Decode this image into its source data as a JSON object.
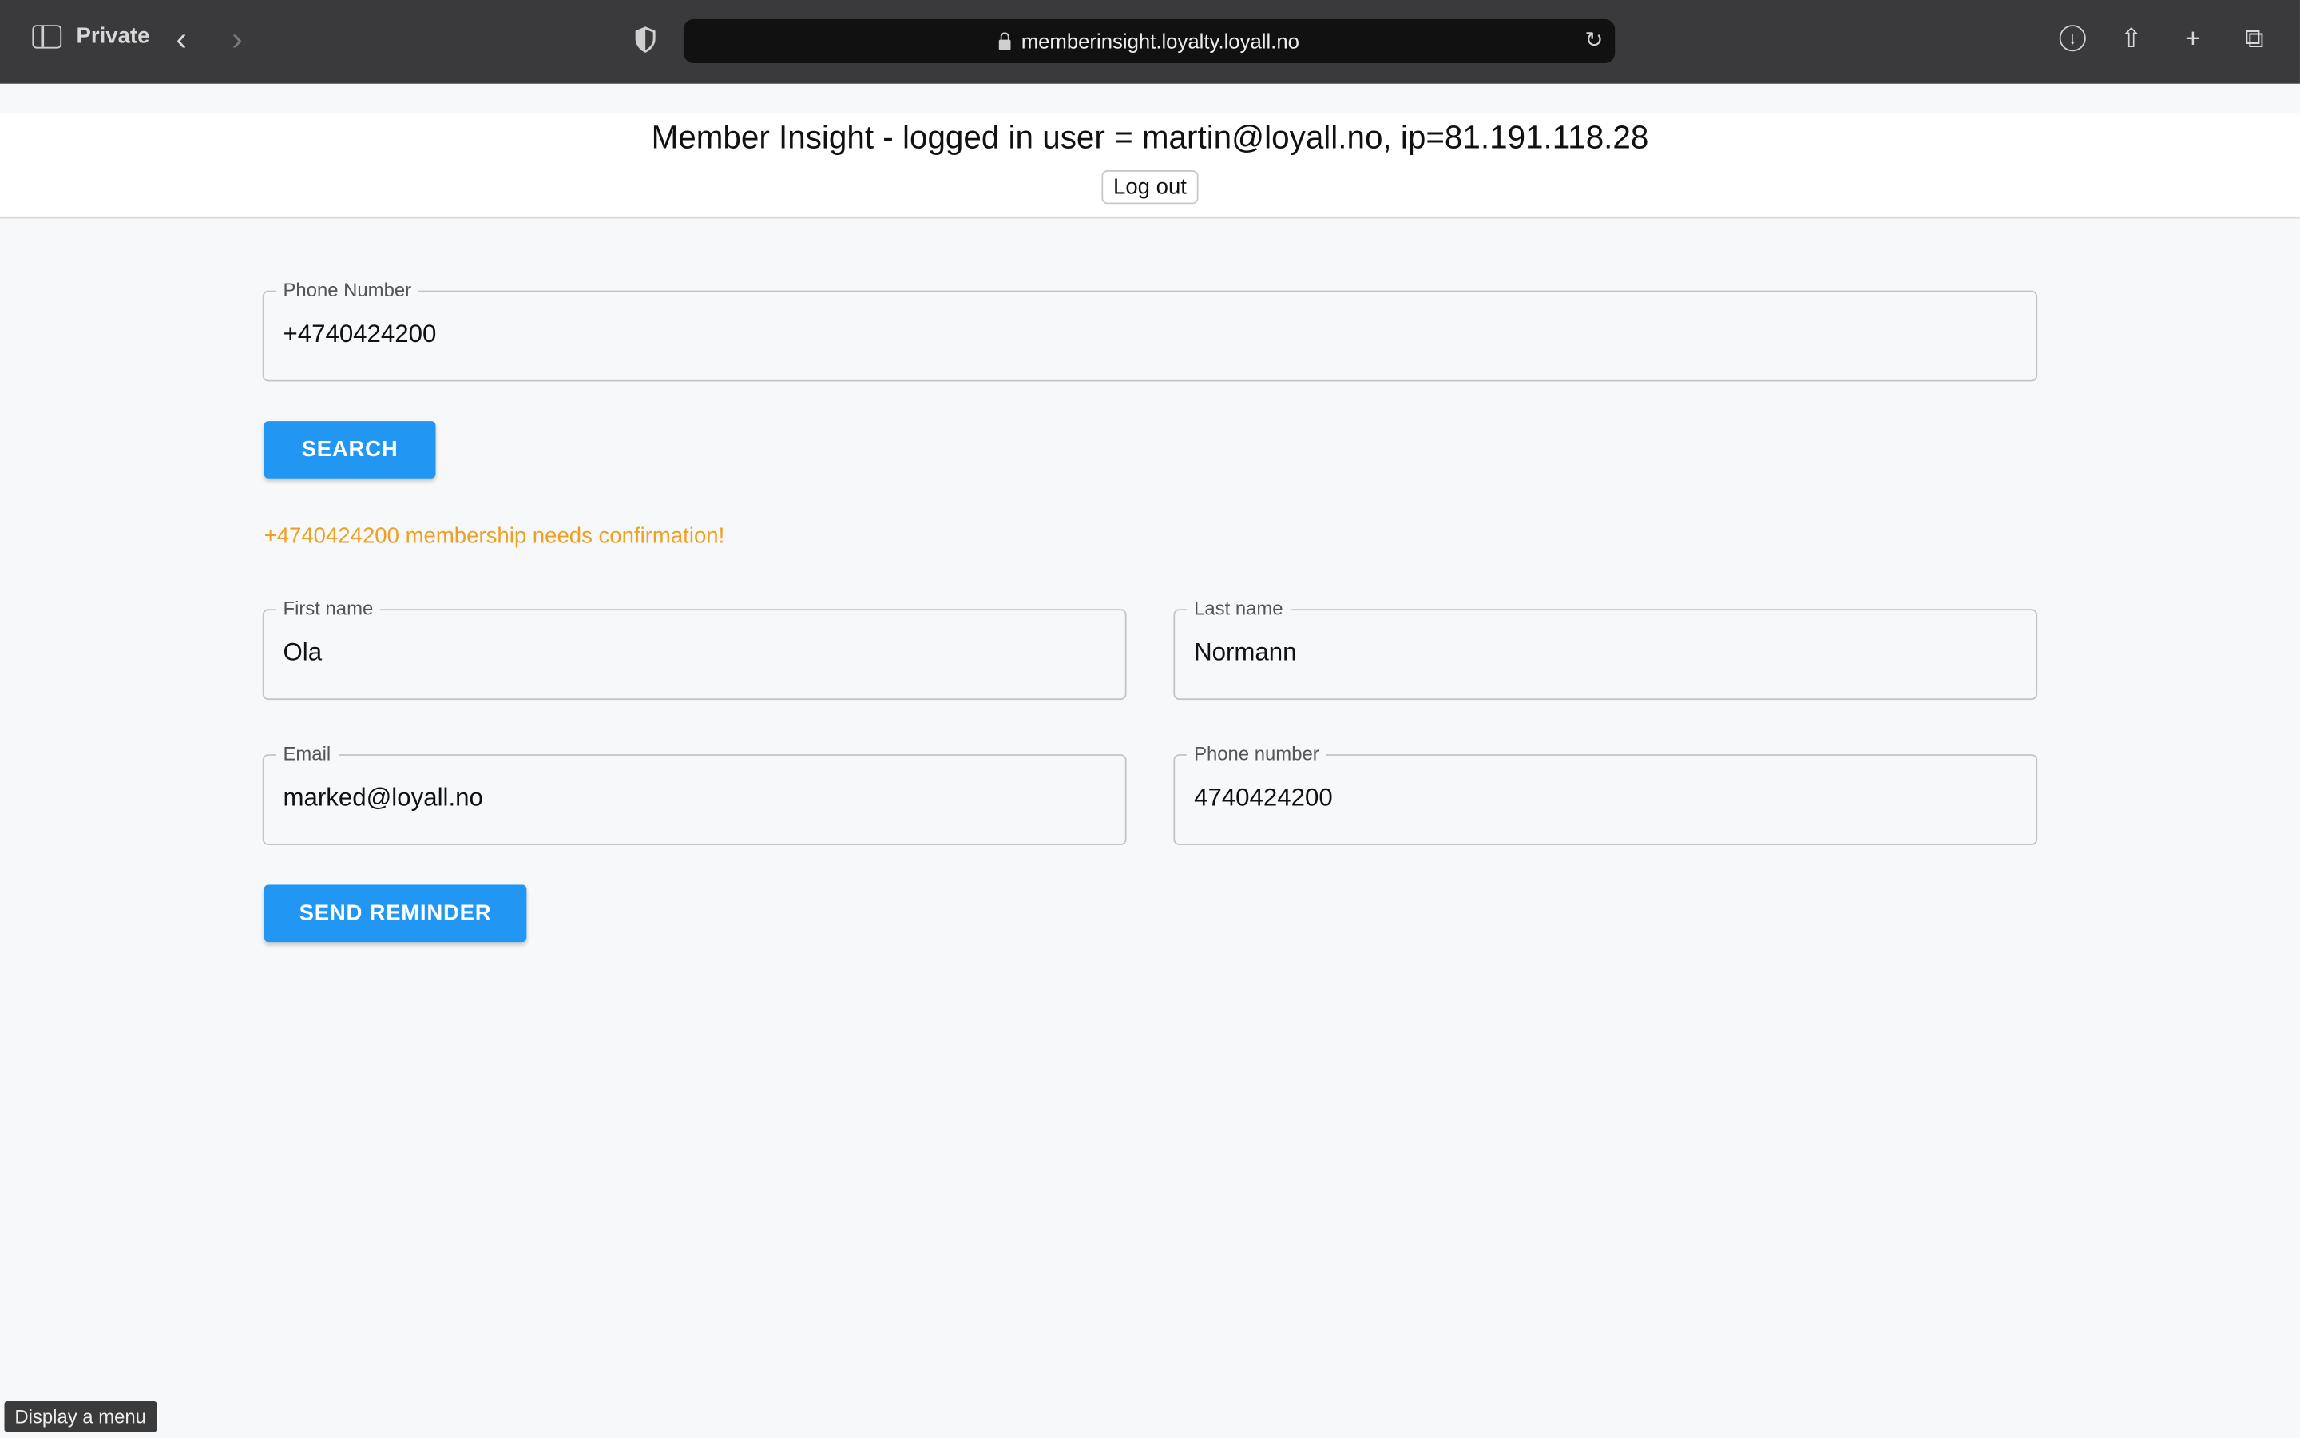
{
  "browser": {
    "private_label": "Private",
    "url": "memberinsight.loyalty.loyall.no"
  },
  "header": {
    "title": "Member Insight - logged in user = martin@loyall.no, ip=81.191.118.28",
    "logout_label": "Log out"
  },
  "search": {
    "label": "Phone Number",
    "value": "+4740424200",
    "button_label": "SEARCH"
  },
  "status_message": "+4740424200 membership needs confirmation!",
  "member": {
    "first_name_label": "First name",
    "first_name": "Ola",
    "last_name_label": "Last name",
    "last_name": "Normann",
    "email_label": "Email",
    "email": "marked@loyall.no",
    "phone_label": "Phone number",
    "phone": "4740424200"
  },
  "actions": {
    "send_reminder_label": "SEND REMINDER"
  },
  "tooltip": "Display a menu",
  "colors": {
    "primary": "#2196f3",
    "warning": "#f0a020"
  }
}
